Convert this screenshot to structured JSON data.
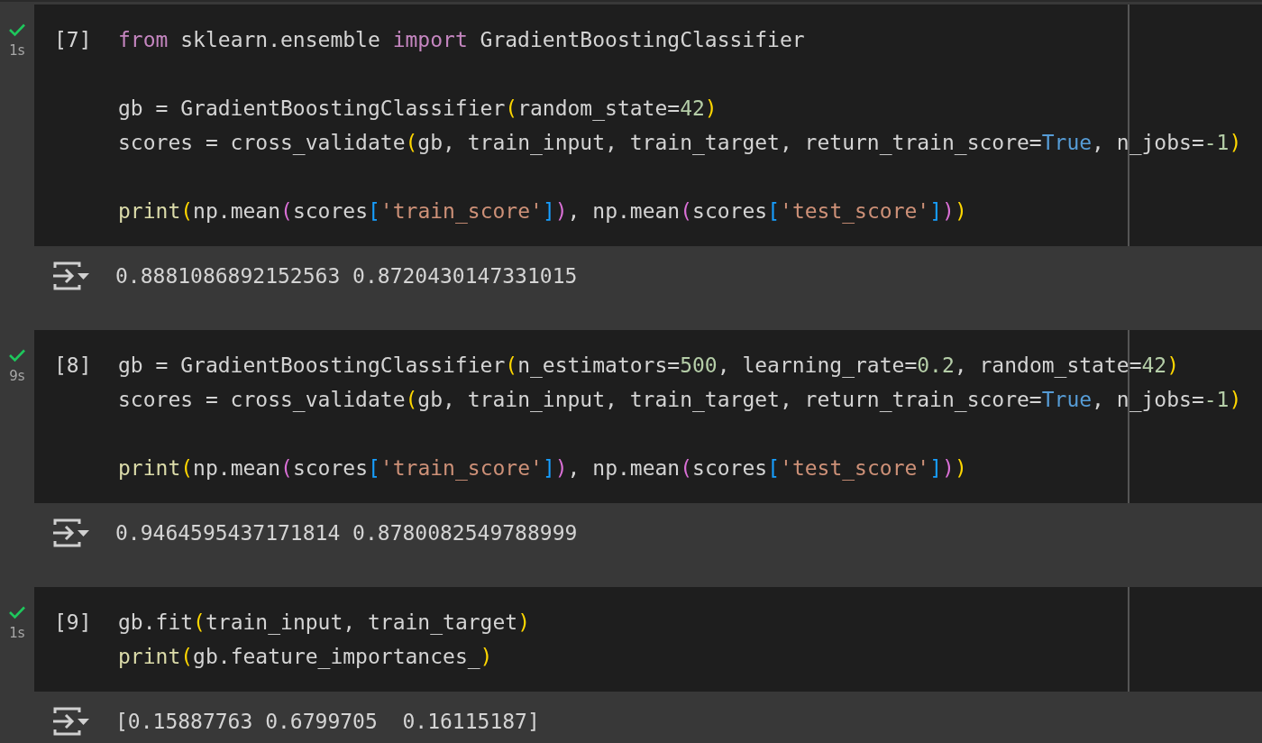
{
  "cells": [
    {
      "succeeded": true,
      "run_time": "1s",
      "execution_count": "[7]",
      "code": [
        {
          "kind": "code",
          "tokens": [
            {
              "text": "from",
              "kind": "keyword"
            },
            {
              "text": " sklearn.ensemble ",
              "kind": "plain"
            },
            {
              "text": "import",
              "kind": "keyword"
            },
            {
              "text": " GradientBoostingClassifier",
              "kind": "plain"
            }
          ]
        },
        {
          "kind": "blank"
        },
        {
          "kind": "code",
          "tokens": [
            {
              "text": "gb = GradientBoostingClassifier",
              "kind": "plain"
            },
            {
              "text": "(",
              "kind": "paren"
            },
            {
              "text": "random_state=",
              "kind": "plain"
            },
            {
              "text": "42",
              "kind": "number"
            },
            {
              "text": ")",
              "kind": "paren"
            }
          ]
        },
        {
          "kind": "code",
          "tokens": [
            {
              "text": "scores = cross_validate",
              "kind": "plain"
            },
            {
              "text": "(",
              "kind": "paren"
            },
            {
              "text": "gb, train_input, train_target, return_train_score=",
              "kind": "plain"
            },
            {
              "text": "True",
              "kind": "constant"
            },
            {
              "text": ", n_jobs=",
              "kind": "plain"
            },
            {
              "text": "-1",
              "kind": "number"
            },
            {
              "text": ")",
              "kind": "paren"
            }
          ]
        },
        {
          "kind": "blank"
        },
        {
          "kind": "code",
          "tokens": [
            {
              "text": "print",
              "kind": "builtin"
            },
            {
              "text": "(",
              "kind": "paren"
            },
            {
              "text": "np.mean",
              "kind": "plain"
            },
            {
              "text": "(",
              "kind": "paren2"
            },
            {
              "text": "scores",
              "kind": "plain"
            },
            {
              "text": "[",
              "kind": "bracket"
            },
            {
              "text": "'train_score'",
              "kind": "string"
            },
            {
              "text": "]",
              "kind": "bracket"
            },
            {
              "text": ")",
              "kind": "paren2"
            },
            {
              "text": ", np.mean",
              "kind": "plain"
            },
            {
              "text": "(",
              "kind": "paren2"
            },
            {
              "text": "scores",
              "kind": "plain"
            },
            {
              "text": "[",
              "kind": "bracket"
            },
            {
              "text": "'test_score'",
              "kind": "string"
            },
            {
              "text": "]",
              "kind": "bracket"
            },
            {
              "text": ")",
              "kind": "paren2"
            },
            {
              "text": ")",
              "kind": "paren"
            }
          ]
        }
      ],
      "output": "0.8881086892152563 0.8720430147331015"
    },
    {
      "succeeded": true,
      "run_time": "9s",
      "execution_count": "[8]",
      "code": [
        {
          "kind": "code",
          "tokens": [
            {
              "text": "gb = GradientBoostingClassifier",
              "kind": "plain"
            },
            {
              "text": "(",
              "kind": "paren"
            },
            {
              "text": "n_estimators=",
              "kind": "plain"
            },
            {
              "text": "500",
              "kind": "number"
            },
            {
              "text": ", learning_rate=",
              "kind": "plain"
            },
            {
              "text": "0.2",
              "kind": "number"
            },
            {
              "text": ", random_state=",
              "kind": "plain"
            },
            {
              "text": "42",
              "kind": "number"
            },
            {
              "text": ")",
              "kind": "paren"
            }
          ]
        },
        {
          "kind": "code",
          "tokens": [
            {
              "text": "scores = cross_validate",
              "kind": "plain"
            },
            {
              "text": "(",
              "kind": "paren"
            },
            {
              "text": "gb, train_input, train_target, return_train_score=",
              "kind": "plain"
            },
            {
              "text": "True",
              "kind": "constant"
            },
            {
              "text": ", n_jobs=",
              "kind": "plain"
            },
            {
              "text": "-1",
              "kind": "number"
            },
            {
              "text": ")",
              "kind": "paren"
            }
          ]
        },
        {
          "kind": "blank"
        },
        {
          "kind": "code",
          "tokens": [
            {
              "text": "print",
              "kind": "builtin"
            },
            {
              "text": "(",
              "kind": "paren"
            },
            {
              "text": "np.mean",
              "kind": "plain"
            },
            {
              "text": "(",
              "kind": "paren2"
            },
            {
              "text": "scores",
              "kind": "plain"
            },
            {
              "text": "[",
              "kind": "bracket"
            },
            {
              "text": "'train_score'",
              "kind": "string"
            },
            {
              "text": "]",
              "kind": "bracket"
            },
            {
              "text": ")",
              "kind": "paren2"
            },
            {
              "text": ", np.mean",
              "kind": "plain"
            },
            {
              "text": "(",
              "kind": "paren2"
            },
            {
              "text": "scores",
              "kind": "plain"
            },
            {
              "text": "[",
              "kind": "bracket"
            },
            {
              "text": "'test_score'",
              "kind": "string"
            },
            {
              "text": "]",
              "kind": "bracket"
            },
            {
              "text": ")",
              "kind": "paren2"
            },
            {
              "text": ")",
              "kind": "paren"
            }
          ]
        }
      ],
      "output": "0.9464595437171814 0.8780082549788999"
    },
    {
      "succeeded": true,
      "run_time": "1s",
      "execution_count": "[9]",
      "code": [
        {
          "kind": "code",
          "tokens": [
            {
              "text": "gb.fit",
              "kind": "plain"
            },
            {
              "text": "(",
              "kind": "paren"
            },
            {
              "text": "train_input, train_target",
              "kind": "plain"
            },
            {
              "text": ")",
              "kind": "paren"
            }
          ]
        },
        {
          "kind": "code",
          "tokens": [
            {
              "text": "print",
              "kind": "builtin"
            },
            {
              "text": "(",
              "kind": "paren"
            },
            {
              "text": "gb.feature_importances_",
              "kind": "plain"
            },
            {
              "text": ")",
              "kind": "paren"
            }
          ]
        }
      ],
      "output": "[0.15887763 0.6799705  0.16115187]"
    }
  ]
}
